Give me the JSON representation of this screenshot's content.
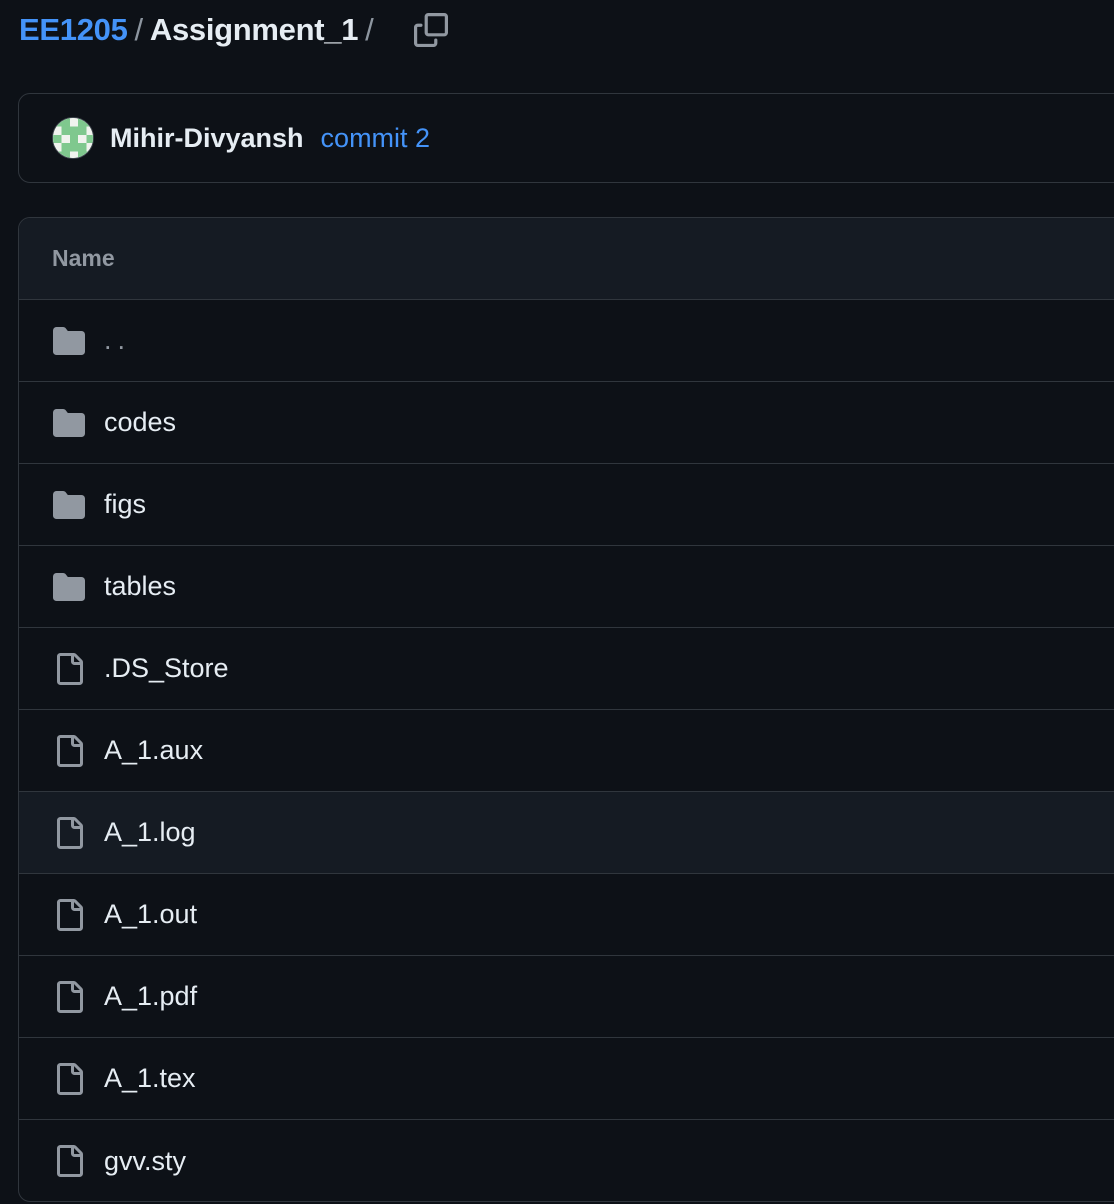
{
  "breadcrumb": {
    "repo": "EE1205",
    "separator": "/",
    "current_dir": "Assignment_1",
    "trailing_separator": "/"
  },
  "commit": {
    "author": "Mihir-Divyansh",
    "message": "commit 2"
  },
  "table": {
    "header": "Name",
    "rows": [
      {
        "label": "..",
        "type": "folder-icon"
      },
      {
        "label": "codes",
        "type": "folder-icon"
      },
      {
        "label": "figs",
        "type": "folder-icon"
      },
      {
        "label": "tables",
        "type": "folder-icon"
      },
      {
        "label": ".DS_Store",
        "type": "file-icon"
      },
      {
        "label": "A_1.aux",
        "type": "file-icon"
      },
      {
        "label": "A_1.log",
        "type": "file-icon"
      },
      {
        "label": "A_1.out",
        "type": "file-icon"
      },
      {
        "label": "A_1.pdf",
        "type": "file-icon"
      },
      {
        "label": "A_1.tex",
        "type": "file-icon"
      },
      {
        "label": "gvv.sty",
        "type": "file-icon"
      }
    ]
  },
  "colors": {
    "background": "#0d1117",
    "link": "#4493f8",
    "border": "#30363d",
    "icon": "#9198a1",
    "avatar_identicon": "#7fc88e"
  }
}
